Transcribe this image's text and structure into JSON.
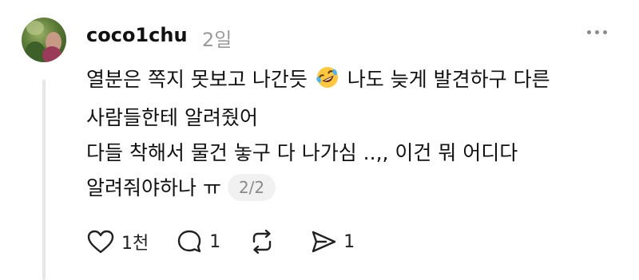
{
  "author": {
    "username": "coco1chu",
    "time_ago": "2일"
  },
  "comment": {
    "line1_before_emoji": "열분은 쪽지 못보고 나간듯",
    "emoji": "rolling-on-floor-laughing-emoji",
    "line1_after_emoji": "나도 늦게 발견하구 다른",
    "line2": "사람들한테 알려줬어",
    "line3": "다들 착해서 물건 놓구 다 나가심 ..,, 이건 뭐 어디다",
    "line4": "알려줘야하나 ㅠ",
    "pager": "2/2"
  },
  "actions": {
    "like_count": "1천",
    "reply_count": "1",
    "repost_count": "",
    "share_count": "1"
  },
  "icons": {
    "like": "heart-icon",
    "reply": "comment-icon",
    "repost": "repost-icon",
    "share": "send-icon",
    "more": "more-horizontal-icon"
  },
  "colors": {
    "text": "#111111",
    "muted": "#9a9a9a",
    "thread_line": "#e6e6e6",
    "pager_bg": "#f1f1f1"
  }
}
